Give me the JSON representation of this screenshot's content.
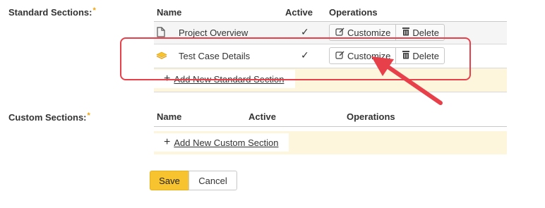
{
  "standard_sections": {
    "label": "Standard Sections:",
    "required_mark": "*",
    "headers": {
      "name": "Name",
      "active": "Active",
      "operations": "Operations"
    },
    "rows": [
      {
        "name": "Project Overview",
        "icon": "document-icon",
        "active_mark": "✓",
        "customize": "Customize",
        "delete": "Delete"
      },
      {
        "name": "Test Case Details",
        "icon": "layers-icon",
        "active_mark": "✓",
        "customize": "Customize",
        "delete": "Delete"
      }
    ],
    "add_link": "Add New Standard Section"
  },
  "custom_sections": {
    "label": "Custom Sections:",
    "required_mark": "*",
    "headers": {
      "name": "Name",
      "active": "Active",
      "operations": "Operations"
    },
    "add_link": "Add New Custom Section"
  },
  "actions": {
    "save": "Save",
    "cancel": "Cancel"
  },
  "colors": {
    "accent_yellow": "#f7c32e",
    "annotation_red": "#e8404a",
    "row_highlight": "#fdf6dc"
  }
}
